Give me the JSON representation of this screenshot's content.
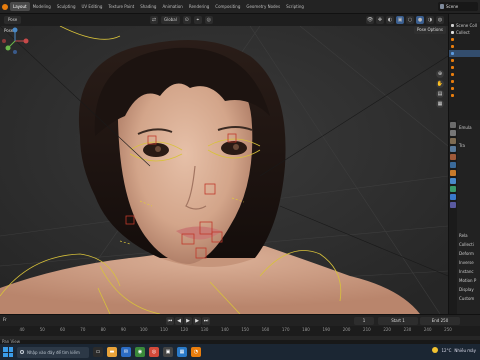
{
  "workspace_tabs": [
    "Layout",
    "Modeling",
    "Sculpting",
    "UV Editing",
    "Texture Paint",
    "Shading",
    "Animation",
    "Rendering",
    "Compositing",
    "Geometry Nodes",
    "Scripting"
  ],
  "active_tab": "Layout",
  "scene_name": "Scene",
  "header": {
    "mode": "Pose",
    "orientation": "Global"
  },
  "viewport": {
    "pose_options": "Pose Options"
  },
  "outliner": {
    "items": [
      "Scene Coll",
      "Collect",
      "",
      "",
      "",
      "",
      "",
      "",
      "",
      "",
      ""
    ]
  },
  "properties": {
    "rows": [
      "Emula",
      "",
      "Tra",
      "",
      "",
      "",
      "",
      "",
      "",
      "",
      "",
      "",
      "Rela",
      "Collecti",
      "Deform",
      "Inverse",
      "Instanc",
      "Motion P",
      "Display",
      "Custom"
    ]
  },
  "timeline": {
    "label": "Fr",
    "ticks": [
      "40",
      "50",
      "60",
      "70",
      "80",
      "90",
      "100",
      "110",
      "120",
      "130",
      "140",
      "150",
      "160",
      "170",
      "180",
      "190",
      "200",
      "210",
      "220",
      "230",
      "240",
      "250"
    ],
    "current_frame": "1",
    "start_label": "Start",
    "start_value": "1",
    "end_label": "End",
    "end_value": "250"
  },
  "status_bar": {
    "left": "Pan View"
  },
  "taskbar": {
    "search_placeholder": "Nhập vào đây để tìm kiếm",
    "temperature": "12°C",
    "weather": "Nhiều mây"
  },
  "colors": {
    "accent_orange": "#e87d0d",
    "selection_blue": "#4772b3",
    "rig_yellow": "#d8c23a",
    "bone_red": "#c0392b"
  }
}
